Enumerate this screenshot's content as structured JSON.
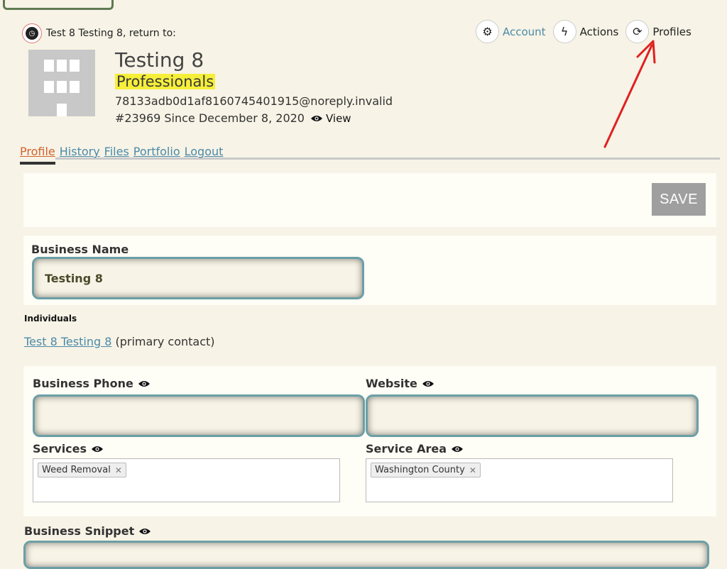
{
  "topbar": {
    "return_text": "Test 8 Testing 8, return to:",
    "actions": [
      {
        "label": "Account",
        "icon": "gear-icon"
      },
      {
        "label": "Actions",
        "icon": "bolt-icon"
      },
      {
        "label": "Profiles",
        "icon": "refresh-icon"
      }
    ]
  },
  "profile": {
    "title": "Testing 8",
    "category": "Professionals",
    "email": "78133adb0d1af8160745401915@noreply.invalid",
    "since": "#23969 Since December 8, 2020",
    "view_label": "View"
  },
  "tabs": [
    {
      "label": "Profile",
      "active": true
    },
    {
      "label": "History",
      "active": false
    },
    {
      "label": "Files",
      "active": false
    },
    {
      "label": "Portfolio",
      "active": false
    },
    {
      "label": "Logout",
      "active": false
    }
  ],
  "save_label": "SAVE",
  "business_name": {
    "label": "Business Name",
    "value": "Testing 8"
  },
  "individuals": {
    "heading": "Individuals",
    "contact_name": "Test 8 Testing 8",
    "contact_role": "(primary contact)"
  },
  "fields": {
    "phone_label": "Business Phone",
    "phone_value": "",
    "website_label": "Website",
    "website_value": "",
    "services_label": "Services",
    "services_tags": [
      "Weed Removal"
    ],
    "area_label": "Service Area",
    "area_tags": [
      "Washington County"
    ],
    "snippet_label": "Business Snippet"
  },
  "colors": {
    "link": "#4a8aa8",
    "active_tab": "#d2632e",
    "highlight": "#f6ef3a",
    "annotation_arrow": "#e02020"
  }
}
